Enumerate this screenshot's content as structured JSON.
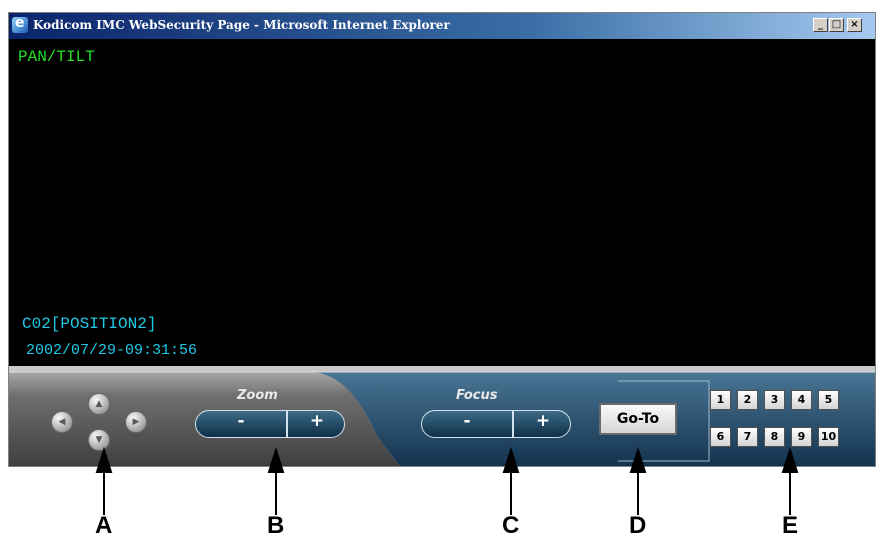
{
  "window": {
    "title": "Kodicom IMC WebSecurity Page - Microsoft Internet Explorer",
    "buttons": {
      "minimize": "_",
      "maximize": "□",
      "close": "×"
    }
  },
  "video": {
    "mode_label": "PAN/TILT",
    "camera_label": "C02[POSITION2]",
    "timestamp": "2002/07/29-09:31:56"
  },
  "controls": {
    "pan_tilt": {
      "up": "▲",
      "down": "▼",
      "left": "◀",
      "right": "▶"
    },
    "zoom": {
      "caption": "Zoom",
      "minus": "-",
      "plus": "+"
    },
    "focus": {
      "caption": "Focus",
      "minus": "-",
      "plus": "+"
    },
    "goto_label": "Go-To",
    "presets": [
      "1",
      "2",
      "3",
      "4",
      "5",
      "6",
      "7",
      "8",
      "9",
      "10"
    ]
  },
  "callouts": [
    "A",
    "B",
    "C",
    "D",
    "E"
  ],
  "colors": {
    "pan_tilt_text": "#22e022",
    "overlay_text": "#1ec8e8",
    "panel_blue": "#1f4a6a"
  }
}
